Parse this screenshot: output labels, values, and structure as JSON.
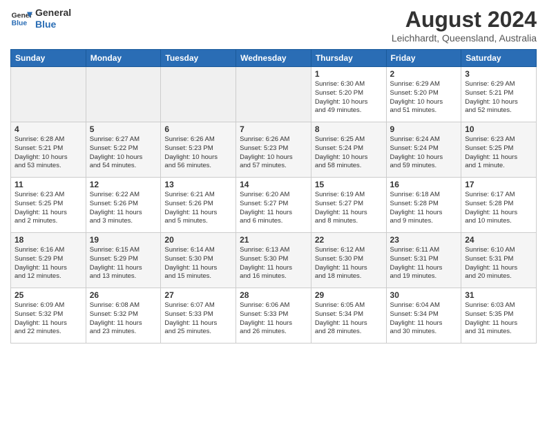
{
  "header": {
    "logo_general": "General",
    "logo_blue": "Blue",
    "main_title": "August 2024",
    "sub_title": "Leichhardt, Queensland, Australia"
  },
  "weekdays": [
    "Sunday",
    "Monday",
    "Tuesday",
    "Wednesday",
    "Thursday",
    "Friday",
    "Saturday"
  ],
  "weeks": [
    [
      {
        "day": "",
        "info": ""
      },
      {
        "day": "",
        "info": ""
      },
      {
        "day": "",
        "info": ""
      },
      {
        "day": "",
        "info": ""
      },
      {
        "day": "1",
        "info": "Sunrise: 6:30 AM\nSunset: 5:20 PM\nDaylight: 10 hours\nand 49 minutes."
      },
      {
        "day": "2",
        "info": "Sunrise: 6:29 AM\nSunset: 5:20 PM\nDaylight: 10 hours\nand 51 minutes."
      },
      {
        "day": "3",
        "info": "Sunrise: 6:29 AM\nSunset: 5:21 PM\nDaylight: 10 hours\nand 52 minutes."
      }
    ],
    [
      {
        "day": "4",
        "info": "Sunrise: 6:28 AM\nSunset: 5:21 PM\nDaylight: 10 hours\nand 53 minutes."
      },
      {
        "day": "5",
        "info": "Sunrise: 6:27 AM\nSunset: 5:22 PM\nDaylight: 10 hours\nand 54 minutes."
      },
      {
        "day": "6",
        "info": "Sunrise: 6:26 AM\nSunset: 5:23 PM\nDaylight: 10 hours\nand 56 minutes."
      },
      {
        "day": "7",
        "info": "Sunrise: 6:26 AM\nSunset: 5:23 PM\nDaylight: 10 hours\nand 57 minutes."
      },
      {
        "day": "8",
        "info": "Sunrise: 6:25 AM\nSunset: 5:24 PM\nDaylight: 10 hours\nand 58 minutes."
      },
      {
        "day": "9",
        "info": "Sunrise: 6:24 AM\nSunset: 5:24 PM\nDaylight: 10 hours\nand 59 minutes."
      },
      {
        "day": "10",
        "info": "Sunrise: 6:23 AM\nSunset: 5:25 PM\nDaylight: 11 hours\nand 1 minute."
      }
    ],
    [
      {
        "day": "11",
        "info": "Sunrise: 6:23 AM\nSunset: 5:25 PM\nDaylight: 11 hours\nand 2 minutes."
      },
      {
        "day": "12",
        "info": "Sunrise: 6:22 AM\nSunset: 5:26 PM\nDaylight: 11 hours\nand 3 minutes."
      },
      {
        "day": "13",
        "info": "Sunrise: 6:21 AM\nSunset: 5:26 PM\nDaylight: 11 hours\nand 5 minutes."
      },
      {
        "day": "14",
        "info": "Sunrise: 6:20 AM\nSunset: 5:27 PM\nDaylight: 11 hours\nand 6 minutes."
      },
      {
        "day": "15",
        "info": "Sunrise: 6:19 AM\nSunset: 5:27 PM\nDaylight: 11 hours\nand 8 minutes."
      },
      {
        "day": "16",
        "info": "Sunrise: 6:18 AM\nSunset: 5:28 PM\nDaylight: 11 hours\nand 9 minutes."
      },
      {
        "day": "17",
        "info": "Sunrise: 6:17 AM\nSunset: 5:28 PM\nDaylight: 11 hours\nand 10 minutes."
      }
    ],
    [
      {
        "day": "18",
        "info": "Sunrise: 6:16 AM\nSunset: 5:29 PM\nDaylight: 11 hours\nand 12 minutes."
      },
      {
        "day": "19",
        "info": "Sunrise: 6:15 AM\nSunset: 5:29 PM\nDaylight: 11 hours\nand 13 minutes."
      },
      {
        "day": "20",
        "info": "Sunrise: 6:14 AM\nSunset: 5:30 PM\nDaylight: 11 hours\nand 15 minutes."
      },
      {
        "day": "21",
        "info": "Sunrise: 6:13 AM\nSunset: 5:30 PM\nDaylight: 11 hours\nand 16 minutes."
      },
      {
        "day": "22",
        "info": "Sunrise: 6:12 AM\nSunset: 5:30 PM\nDaylight: 11 hours\nand 18 minutes."
      },
      {
        "day": "23",
        "info": "Sunrise: 6:11 AM\nSunset: 5:31 PM\nDaylight: 11 hours\nand 19 minutes."
      },
      {
        "day": "24",
        "info": "Sunrise: 6:10 AM\nSunset: 5:31 PM\nDaylight: 11 hours\nand 20 minutes."
      }
    ],
    [
      {
        "day": "25",
        "info": "Sunrise: 6:09 AM\nSunset: 5:32 PM\nDaylight: 11 hours\nand 22 minutes."
      },
      {
        "day": "26",
        "info": "Sunrise: 6:08 AM\nSunset: 5:32 PM\nDaylight: 11 hours\nand 23 minutes."
      },
      {
        "day": "27",
        "info": "Sunrise: 6:07 AM\nSunset: 5:33 PM\nDaylight: 11 hours\nand 25 minutes."
      },
      {
        "day": "28",
        "info": "Sunrise: 6:06 AM\nSunset: 5:33 PM\nDaylight: 11 hours\nand 26 minutes."
      },
      {
        "day": "29",
        "info": "Sunrise: 6:05 AM\nSunset: 5:34 PM\nDaylight: 11 hours\nand 28 minutes."
      },
      {
        "day": "30",
        "info": "Sunrise: 6:04 AM\nSunset: 5:34 PM\nDaylight: 11 hours\nand 30 minutes."
      },
      {
        "day": "31",
        "info": "Sunrise: 6:03 AM\nSunset: 5:35 PM\nDaylight: 11 hours\nand 31 minutes."
      }
    ]
  ]
}
